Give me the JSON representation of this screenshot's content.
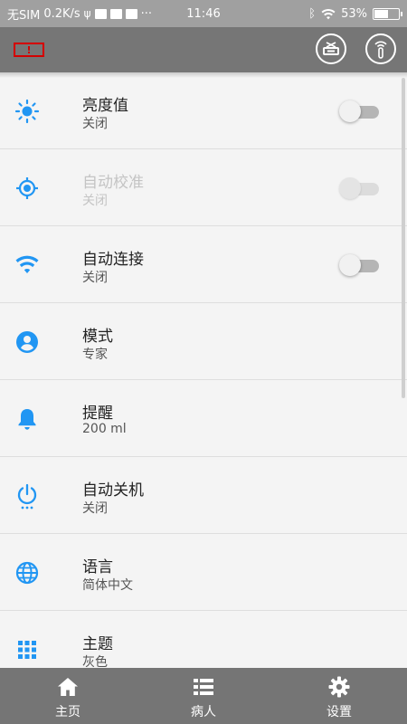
{
  "status_bar": {
    "carrier": "无SIM",
    "speed": "0.2K/s",
    "time": "11:46",
    "dots": "···",
    "battery": "53%"
  },
  "app_bar": {
    "device_battery_mark": "!"
  },
  "settings": [
    {
      "title": "亮度值",
      "value": "关闭",
      "icon": "brightness-icon",
      "toggle": true,
      "enabled": true
    },
    {
      "title": "自动校准",
      "value": "关闭",
      "icon": "gps-target-icon",
      "toggle": true,
      "enabled": false
    },
    {
      "title": "自动连接",
      "value": "关闭",
      "icon": "wifi-icon",
      "toggle": true,
      "enabled": true
    },
    {
      "title": "模式",
      "value": "专家",
      "icon": "account-circle-icon",
      "toggle": false,
      "enabled": true
    },
    {
      "title": "提醒",
      "value": "200 ml",
      "icon": "bell-icon",
      "toggle": false,
      "enabled": true
    },
    {
      "title": "自动关机",
      "value": "关闭",
      "icon": "power-icon",
      "toggle": false,
      "enabled": true
    },
    {
      "title": "语言",
      "value": "简体中文",
      "icon": "globe-icon",
      "toggle": false,
      "enabled": true
    },
    {
      "title": "主题",
      "value": "灰色",
      "icon": "grid-icon",
      "toggle": false,
      "enabled": true
    }
  ],
  "bottom_nav": [
    {
      "label": "主页",
      "icon": "home-icon"
    },
    {
      "label": "病人",
      "icon": "list-icon"
    },
    {
      "label": "设置",
      "icon": "gear-icon"
    }
  ],
  "colors": {
    "accent": "#2196f3",
    "app_bar": "#767676",
    "bottom_nav": "#757575",
    "warning": "#d40000"
  }
}
